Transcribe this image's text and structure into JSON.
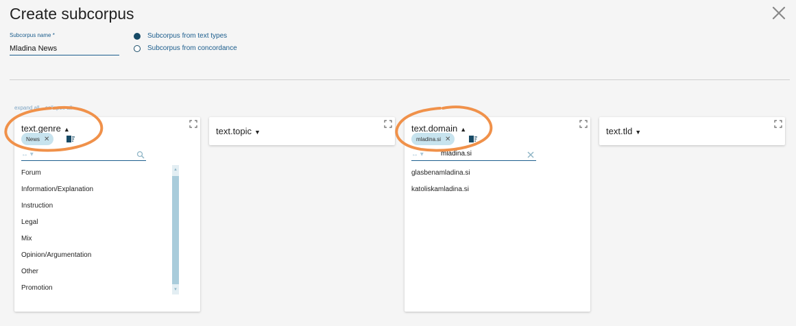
{
  "dialog": {
    "title": "Create subcorpus",
    "subcorpus_name_label": "Subcorpus name *",
    "subcorpus_name_value": "Mladina News",
    "radio_options": [
      {
        "label": "Subcorpus from text types",
        "selected": true
      },
      {
        "label": "Subcorpus from concordance",
        "selected": false
      }
    ]
  },
  "toolbar": {
    "expand_all": "expand all",
    "collapse_all": "collapse all"
  },
  "cards": {
    "genre": {
      "title": "text.genre",
      "expanded": true,
      "chip": "News",
      "filter_value": "",
      "items": [
        "Forum",
        "Information/Explanation",
        "Instruction",
        "Legal",
        "Mix",
        "Opinion/Argumentation",
        "Other",
        "Promotion"
      ]
    },
    "topic": {
      "title": "text.topic",
      "expanded": false
    },
    "domain": {
      "title": "text.domain",
      "expanded": true,
      "chip": "mladina.si",
      "filter_value": "mladina.si",
      "items": [
        "glasbenamladina.si",
        "katoliskamladina.si"
      ]
    },
    "tld": {
      "title": "text.tld",
      "expanded": false
    }
  },
  "colors": {
    "accent": "#1a5c8c",
    "chip_bg": "#c7e3ee",
    "annotation": "#f0914a"
  },
  "icons": {
    "close": "close-icon",
    "maximize": "maximize-icon",
    "clear_all": "clear-all-icon",
    "search": "search-icon",
    "clear_filter": "clear-filter-icon",
    "filter_ops": "filter-options-icon"
  }
}
